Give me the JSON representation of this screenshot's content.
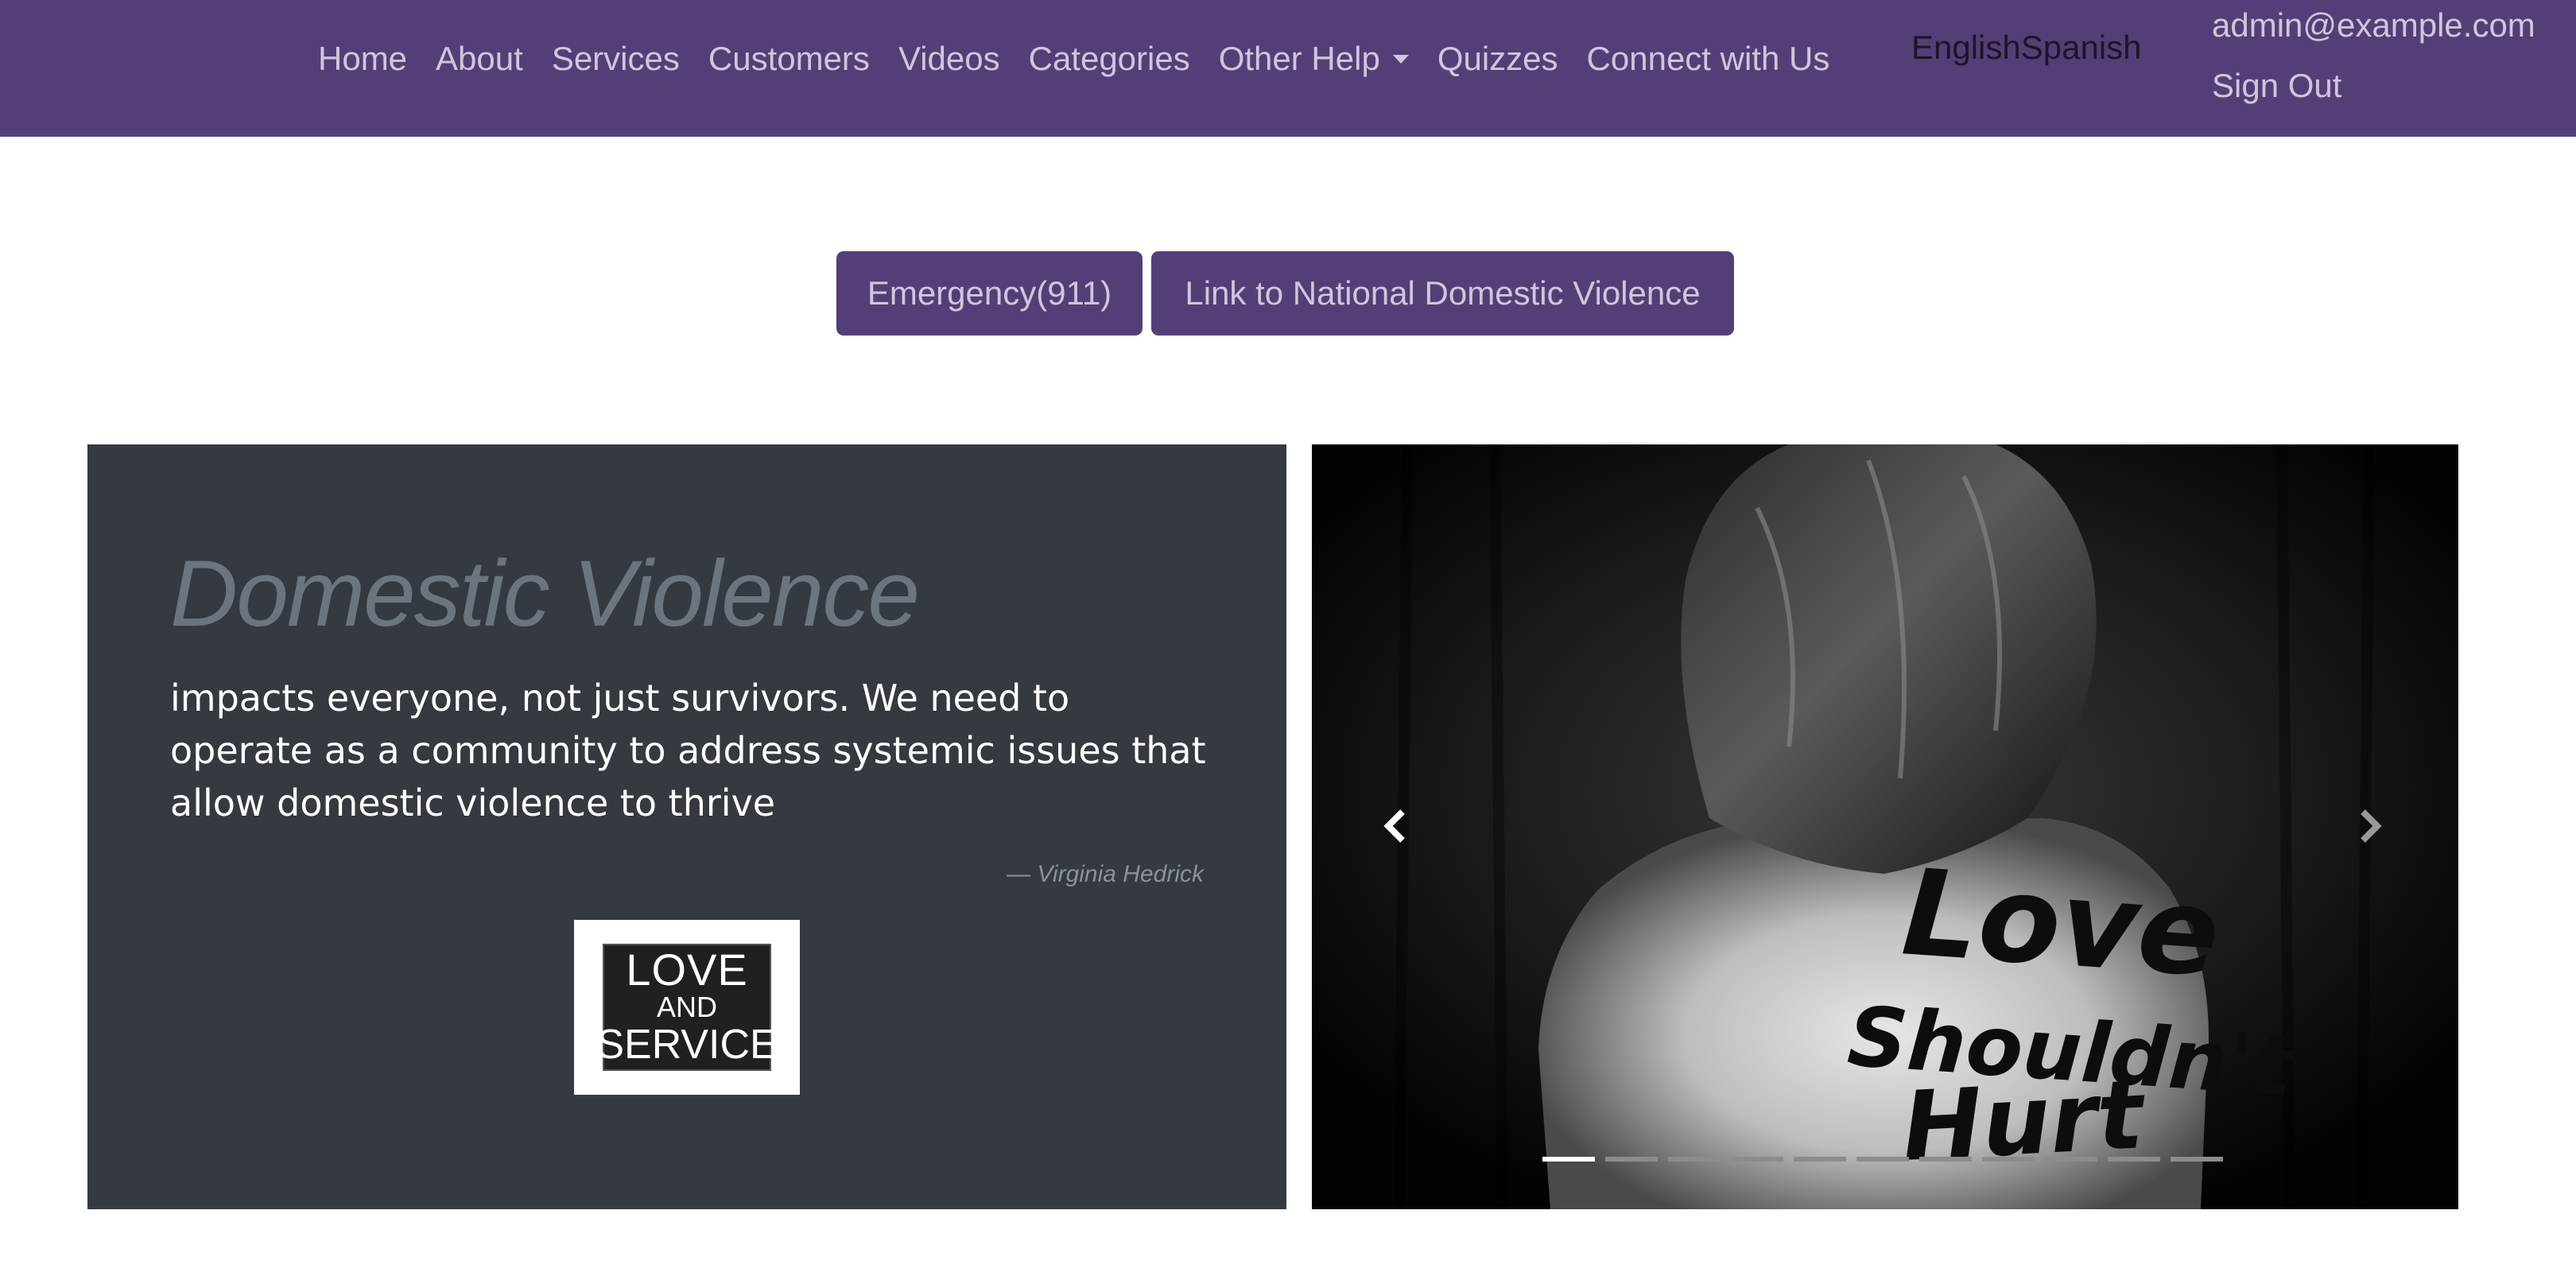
{
  "navbar": {
    "links": [
      "Home",
      "About",
      "Services",
      "Customers",
      "Videos",
      "Categories",
      "Other Help",
      "Quizzes",
      "Connect with Us"
    ],
    "dropdown_link": "Other Help",
    "languages": [
      "English",
      "Spanish"
    ],
    "user_email": "admin@example.com",
    "sign_out": "Sign Out"
  },
  "actions": {
    "emergency": "Emergency(911)",
    "national": "Link to National Domestic Violence"
  },
  "quote": {
    "title": "Domestic Violence",
    "text": "impacts everyone, not just survivors. We need to operate as a community to address systemic issues that allow domestic violence to thrive",
    "author": "— Virginia Hedrick",
    "logo": {
      "line1": "LOVE",
      "line2": "AND",
      "line3": "SERVICE"
    }
  },
  "carousel": {
    "painted_text": [
      "Love",
      "Shouldn't",
      "Hurt"
    ],
    "slide_count": 11,
    "active_slide": 1
  },
  "colors": {
    "brand": "#533f77",
    "nav_text": "#cfc6dd",
    "panel": "#343a40"
  },
  "icons": [
    "chevron-left-icon",
    "chevron-right-icon",
    "caret-down-icon"
  ]
}
